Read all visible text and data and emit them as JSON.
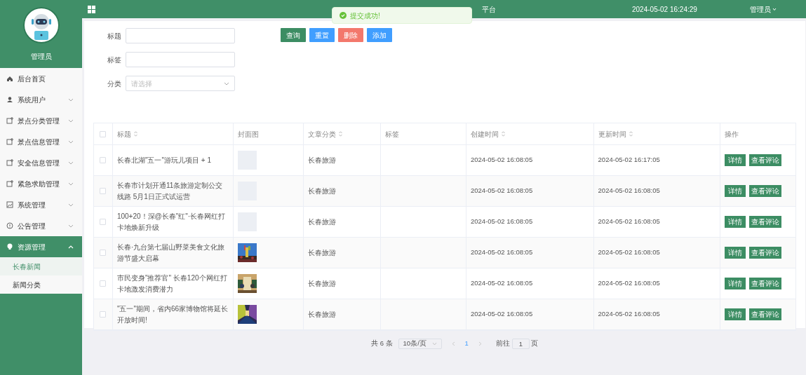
{
  "sidebar": {
    "user": "管理员",
    "items": [
      {
        "label": "后台首页",
        "kind": "link",
        "selected": false
      },
      {
        "label": "系统用户",
        "kind": "submenu",
        "expanded": false,
        "selected": false
      },
      {
        "label": "景点分类管理",
        "kind": "submenu",
        "expanded": false,
        "selected": false
      },
      {
        "label": "景点信息管理",
        "kind": "submenu",
        "expanded": false,
        "selected": false
      },
      {
        "label": "安全信息管理",
        "kind": "submenu",
        "expanded": false,
        "selected": false
      },
      {
        "label": "紧急求助管理",
        "kind": "submenu",
        "expanded": false,
        "selected": false
      },
      {
        "label": "系统管理",
        "kind": "submenu",
        "expanded": false,
        "selected": false
      },
      {
        "label": "公告管理",
        "kind": "submenu",
        "expanded": false,
        "selected": false
      },
      {
        "label": "资源管理",
        "kind": "submenu",
        "expanded": true,
        "selected": true,
        "children": [
          {
            "label": "长春新闻",
            "selected": true
          },
          {
            "label": "新闻分类",
            "selected": false
          }
        ]
      }
    ]
  },
  "header": {
    "title": "平台",
    "datetime": "2024-05-02 16:24:29",
    "user": "管理员"
  },
  "toast": {
    "message": "提交成功!"
  },
  "filters": [
    {
      "label": "标题",
      "kind": "text"
    },
    {
      "label": "标签",
      "kind": "text"
    },
    {
      "label": "分类",
      "kind": "select",
      "placeholder": "请选择"
    }
  ],
  "buttons": [
    {
      "label": "查询",
      "kind": "primary"
    },
    {
      "label": "重置",
      "kind": "info"
    },
    {
      "label": "删除",
      "kind": "danger"
    },
    {
      "label": "添加",
      "kind": "info"
    }
  ],
  "table": {
    "header_checked": false,
    "columns": [
      {
        "label": "标题",
        "sortable": true
      },
      {
        "label": "封面图",
        "sortable": false
      },
      {
        "label": "文章分类",
        "sortable": true
      },
      {
        "label": "标签",
        "sortable": false
      },
      {
        "label": "创建时间",
        "sortable": true
      },
      {
        "label": "更新时间",
        "sortable": true
      },
      {
        "label": "操作",
        "sortable": false
      }
    ],
    "rows": [
      {
        "checked": false,
        "title": "长春北湖\"五一\"游玩儿项目 + 1",
        "kind": "no_cover",
        "category": "长春旅游",
        "created": "2024-05-02 16:08:05",
        "updated": "2024-05-02 16:17:05",
        "actions": [
          "详情",
          "查看评论"
        ]
      },
      {
        "checked": false,
        "title": "长春市计划开通11条旅游定制公交线路 5月1日正式试运营",
        "kind": "no_cover",
        "category": "长春旅游",
        "created": "2024-05-02 16:08:05",
        "updated": "2024-05-02 16:08:05",
        "actions": [
          "详情",
          "查看评论"
        ]
      },
      {
        "checked": false,
        "title": "100+20！深@长春\"红\"·长春网红打卡地焕新升级",
        "kind": "no_cover",
        "category": "长春旅游",
        "created": "2024-05-02 16:08:05",
        "updated": "2024-05-02 16:08:05",
        "actions": [
          "详情",
          "查看评论"
        ]
      },
      {
        "checked": false,
        "title": "长春·九台第七届山野菜美食文化旅游节盛大启幕",
        "kind": "picture",
        "category": "长春旅游",
        "created": "2024-05-02 16:08:05",
        "updated": "2024-05-02 16:08:05",
        "actions": [
          "详情",
          "查看评论"
        ]
      },
      {
        "checked": false,
        "title": "市民变身\"推荐官\" 长春120个网红打卡地激发消费潜力",
        "kind": "picture",
        "category": "长春旅游",
        "created": "2024-05-02 16:08:05",
        "updated": "2024-05-02 16:08:05",
        "actions": [
          "详情",
          "查看评论"
        ]
      },
      {
        "checked": false,
        "title": "\"五一\"期间，省内66家博物馆将延长开放时间!",
        "kind": "picture",
        "category": "长春旅游",
        "created": "2024-05-02 16:08:05",
        "updated": "2024-05-02 16:08:05",
        "actions": [
          "详情",
          "查看评论"
        ]
      }
    ]
  },
  "pagination": {
    "total": "共 6 条",
    "page_size": "10条/页",
    "pages": [
      {
        "label": "1",
        "selected": true
      }
    ],
    "goto_label": "前往",
    "goto_value": "1",
    "goto_suffix": "页"
  }
}
